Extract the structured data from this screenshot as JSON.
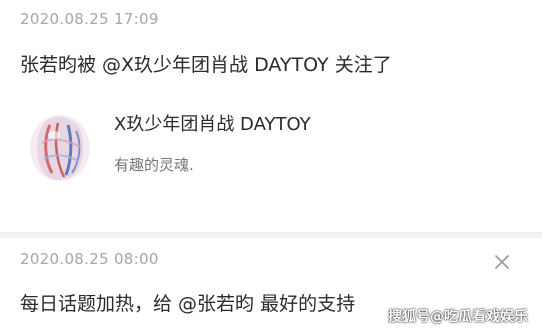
{
  "feed": [
    {
      "timestamp": "2020.08.25 17:09",
      "text": "张若昀被 @X玖少年团肖战 DAYTOY 关注了",
      "card": {
        "name": "X玖少年团肖战 DAYTOY",
        "bio": "有趣的灵魂."
      }
    },
    {
      "timestamp": "2020.08.25 08:00",
      "text": "每日话题加热，给 @张若昀 最好的支持",
      "dismiss_icon": "close-icon"
    }
  ],
  "watermark": "搜狐号@吃瓜看戏娱乐",
  "colors": {
    "timestamp": "#a6a6a6",
    "text": "#2b2b2b",
    "secondary": "#777777",
    "divider": "#f2f2f2"
  }
}
